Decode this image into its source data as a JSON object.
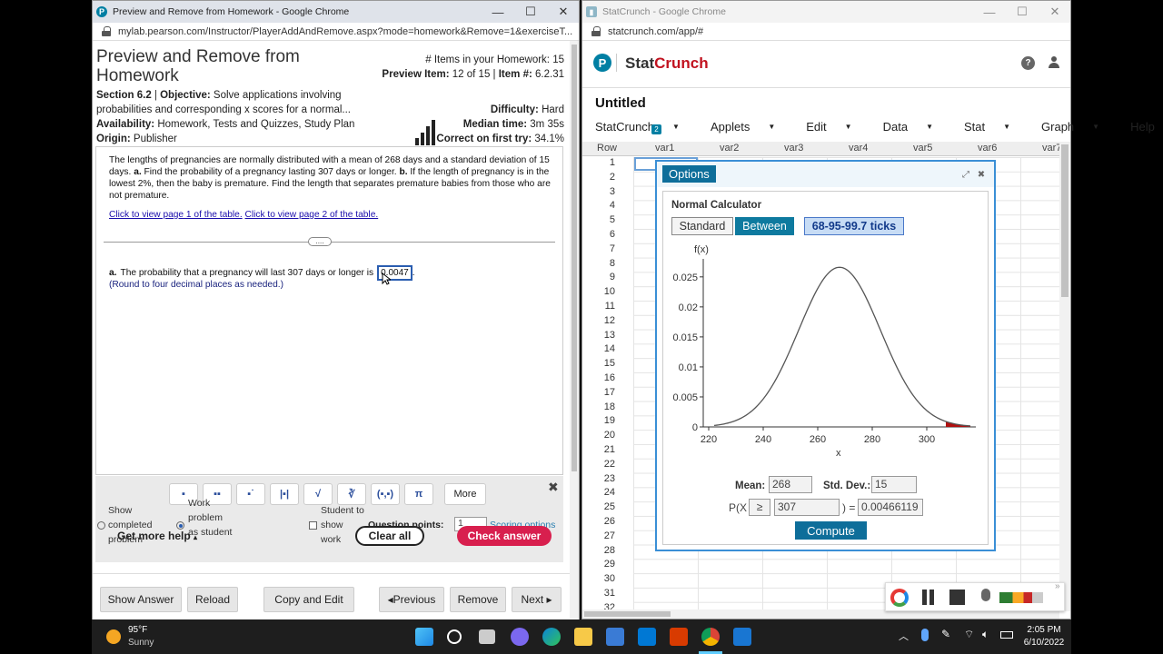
{
  "left_window": {
    "title": "Preview and Remove from Homework - Google Chrome",
    "url": "mylab.pearson.com/Instructor/PlayerAddAndRemove.aspx?mode=homework&Remove=1&exerciseT...",
    "page_title": "Preview and Remove from Homework",
    "items_count": "# Items in your Homework: 15",
    "preview_item_label": "Preview Item:",
    "preview_item_value": "12 of 15 |",
    "item_num_label": "Item #:",
    "item_num_value": "6.2.31",
    "section": "Section 6.2",
    "objective_label": "Objective:",
    "objective_text": "Solve applications involving probabilities and corresponding x scores for a normal...",
    "availability_label": "Availability:",
    "availability_text": "Homework, Tests and Quizzes, Study Plan",
    "origin_label": "Origin:",
    "origin_text": "Publisher",
    "difficulty_label": "Difficulty:",
    "difficulty_value": "Hard",
    "median_label": "Median time:",
    "median_value": "3m 35s",
    "correct_label": "Correct on first try:",
    "correct_value": "34.1%",
    "question_part1": "The lengths of pregnancies are normally distributed with a mean of 268 days and a standard deviation of 15 days.",
    "question_a_label": "a.",
    "question_a_text": "Find the probability of a pregnancy lasting 307 days or longer.",
    "question_b_label": "b.",
    "question_b_text": "If the length of pregnancy is in the lowest 2%, then the baby is premature. Find the length that separates premature babies from those who are not premature.",
    "link1": "Click to view page 1 of the table.",
    "link2": "Click to view page 2 of the table.",
    "dots": "....",
    "answer_label": "a.",
    "answer_text": "The probability that a pregnancy will last 307 days or longer is",
    "answer_value": "0.0047",
    "answer_period": ".",
    "round_note": "(Round to four decimal places as needed.)",
    "tools": [
      "▪",
      "▪▪",
      "▪˙",
      "|▪|",
      "√",
      "∛",
      "(▪,▪)",
      "π"
    ],
    "more": "More",
    "close": "✖",
    "show_completed": "Show completed problem",
    "work_problem": "Work problem as student",
    "student_show_work": "Student to show work",
    "question_points_label": "Question points:",
    "question_points_value": "1",
    "scoring_options": "Scoring options",
    "get_more_help": "Get more help",
    "clear_all": "Clear all",
    "check_answer": "Check answer",
    "footer_buttons": {
      "show_answer": "Show Answer",
      "reload": "Reload",
      "copy_edit": "Copy and Edit",
      "previous": "◂Previous",
      "remove": "Remove",
      "next": "Next ▸"
    }
  },
  "right_window": {
    "title": "StatCrunch - Google Chrome",
    "url": "statcrunch.com/app/#",
    "brand_stat": "Stat",
    "brand_crunch": "Crunch",
    "help": "?",
    "doc_title": "Untitled",
    "menu": [
      "StatCrunch",
      "Applets",
      "Edit",
      "Data",
      "Stat",
      "Graph",
      "Help"
    ],
    "menu_badge": "2",
    "grid_headers": [
      "Row",
      "var1",
      "var2",
      "var3",
      "var4",
      "var5",
      "var6",
      "var7"
    ],
    "rows": [
      "1",
      "2",
      "3",
      "4",
      "5",
      "6",
      "7",
      "8",
      "9",
      "10",
      "11",
      "12",
      "13",
      "14",
      "15",
      "16",
      "17",
      "18",
      "19",
      "20",
      "21",
      "22",
      "23",
      "24",
      "25",
      "26",
      "27",
      "28",
      "29",
      "30",
      "31",
      "32"
    ],
    "dialog": {
      "tab": "Options",
      "title": "Normal Calculator",
      "standard": "Standard",
      "between": "Between",
      "ticks": "68-95-99.7 ticks",
      "mean_label": "Mean:",
      "mean_value": "268",
      "sd_label": "Std. Dev.:",
      "sd_value": "15",
      "p_prefix": "P(X",
      "op": "≥",
      "x_value": "307",
      "p_suffix": ") =",
      "result": "0.00466119",
      "compute": "Compute"
    }
  },
  "chart_data": {
    "type": "line",
    "ylabel": "f(x)",
    "xlabel": "x",
    "xticks": [
      "220",
      "240",
      "260",
      "280",
      "300"
    ],
    "yticks": [
      "0",
      "0.005",
      "0.01",
      "0.015",
      "0.02",
      "0.025"
    ],
    "xlim": [
      218,
      318
    ],
    "ylim": [
      0,
      0.028
    ],
    "mean": 268,
    "sd": 15,
    "shade_from": 307,
    "curve_color": "#555555",
    "shade_color": "#b01010"
  },
  "taskbar": {
    "weather_temp": "95°F",
    "weather_desc": "Sunny",
    "time": "2:05 PM",
    "date": "6/10/2022"
  }
}
